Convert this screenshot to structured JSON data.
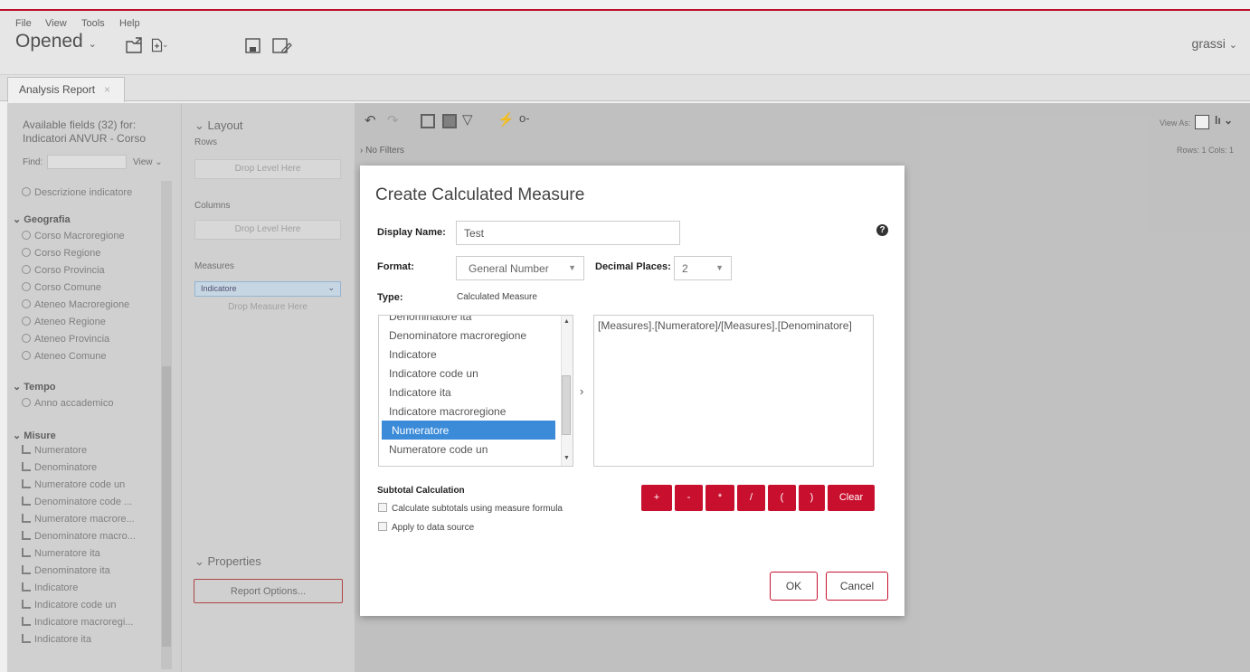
{
  "menu": {
    "file": "File",
    "view": "View",
    "tools": "Tools",
    "help": "Help"
  },
  "toolbar": {
    "opened": "Opened",
    "user": "grassi"
  },
  "tab": {
    "label": "Analysis Report",
    "close": "×"
  },
  "left": {
    "available": "Available fields (32) for:",
    "cube": "Indicatori ANVUR - Corso",
    "find_label": "Find:",
    "view_label": "View",
    "top_field": "Descrizione indicatore",
    "groups": [
      {
        "name": "Geografia",
        "items": [
          "Corso Macroregione",
          "Corso Regione",
          "Corso Provincia",
          "Corso Comune",
          "Ateneo Macroregione",
          "Ateneo Regione",
          "Ateneo Provincia",
          "Ateneo Comune"
        ]
      },
      {
        "name": "Tempo",
        "items": [
          "Anno accademico"
        ]
      },
      {
        "name": "Misure",
        "items": [
          "Numeratore",
          "Denominatore",
          "Numeratore code un",
          "Denominatore code ...",
          "Numeratore macrore...",
          "Denominatore macro...",
          "Numeratore ita",
          "Denominatore ita",
          "Indicatore",
          "Indicatore code un",
          "Indicatore macroregi...",
          "Indicatore ita"
        ]
      }
    ]
  },
  "layout": {
    "title": "Layout",
    "rows": "Rows",
    "columns": "Columns",
    "measures": "Measures",
    "drop_level": "Drop Level Here",
    "drop_measure": "Drop Measure Here",
    "measure_item": "Indicatore",
    "properties": "Properties",
    "report_options": "Report Options..."
  },
  "report": {
    "no_filters": "No Filters",
    "view_as": "View As:",
    "rows_cols": "Rows: 1  Cols: 1"
  },
  "dialog": {
    "title": "Create Calculated Measure",
    "display_name_label": "Display Name:",
    "display_name_value": "Test",
    "format_label": "Format:",
    "format_value": "General Number",
    "decimal_label": "Decimal Places:",
    "decimal_value": "2",
    "type_label": "Type:",
    "type_value": "Calculated Measure",
    "list_partial": "Denominatore ita",
    "list_items": [
      "Denominatore macroregione",
      "Indicatore",
      "Indicatore code un",
      "Indicatore ita",
      "Indicatore macroregione",
      "Numeratore",
      "Numeratore code un"
    ],
    "selected_item": "Numeratore",
    "formula": "[Measures].[Numeratore]/[Measures].[Denominatore]",
    "subtotal_title": "Subtotal Calculation",
    "chk1": "Calculate subtotals using measure formula",
    "chk2": "Apply to data source",
    "ops": [
      "+",
      "-",
      "*",
      "/",
      "(",
      ")",
      "Clear"
    ],
    "ok": "OK",
    "cancel": "Cancel",
    "help": "?"
  }
}
